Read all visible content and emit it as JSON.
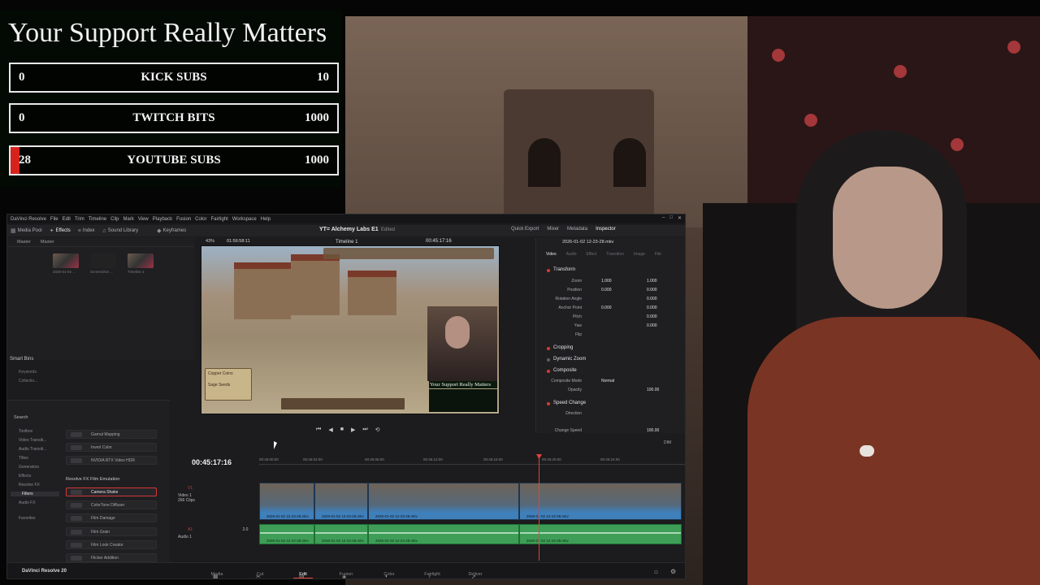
{
  "overlay": {
    "title": "Your Support Really Matters",
    "goals": [
      {
        "current": "0",
        "label": "KICK SUBS",
        "goal": "10",
        "progress": 0
      },
      {
        "current": "0",
        "label": "TWITCH BITS",
        "goal": "1000",
        "progress": 0
      },
      {
        "current": "28",
        "label": "YOUTUBE SUBS",
        "goal": "1000",
        "progress": 0.028
      }
    ]
  },
  "resolve": {
    "menu": [
      "DaVinci Resolve",
      "File",
      "Edit",
      "Trim",
      "Timeline",
      "Clip",
      "Mark",
      "View",
      "Playback",
      "Fusion",
      "Color",
      "Fairlight",
      "Workspace",
      "Help"
    ],
    "toolbar": {
      "media_pool": "Media Pool",
      "effects": "Effects",
      "index": "Index",
      "sound_library": "Sound Library",
      "keyframes": "Keyframes",
      "quick_export": "Quick Export",
      "mixer": "Mixer",
      "metadata": "Metadata",
      "inspector": "Inspector"
    },
    "project_title": "YT= Alchemy Labs E1",
    "edited": "Edited",
    "viewer": {
      "zoom": "43%",
      "source_tc": "01:56:58:11",
      "timeline_name": "Timeline 1",
      "record_tc": "00:45:17:16",
      "pip_title": "Your Support Really Matters",
      "note_line1": "Copper Coins",
      "note_line2": "Sage Seeds"
    },
    "media_pool": {
      "tab_master": "Master",
      "bin_master": "Master",
      "clips": [
        "2026-01-02 ...",
        "Screenshot ...",
        "Timeline 1"
      ],
      "smart_bins": "Smart Bins",
      "keywords": "Keywords",
      "collections": "Collectio..."
    },
    "effects_library": {
      "search": "Search",
      "tree": [
        "Toolbox",
        "Video Transiti...",
        "Audio Transiti...",
        "Titles",
        "Generators",
        "Effects",
        "Resolve FX",
        "Filters",
        "Audio FX",
        "Favorites"
      ],
      "items_top": [
        "Gamut Mapping",
        "Invert Color",
        "NVIDIA RTX Video HDR"
      ],
      "section": "Resolve FX Film Emulation",
      "items": [
        "Camera Shake",
        "ColorTone Diffuser",
        "Film Damage",
        "Film Grain",
        "Film Look Creator",
        "Flicker Addition"
      ]
    },
    "inspector": {
      "file": "2026-01-02 12-23-28.mkv",
      "tabs": [
        "Video",
        "Audio",
        "Effect",
        "Transition",
        "Image",
        "File"
      ],
      "transform": "Transform",
      "zoom": {
        "label": "Zoom",
        "x": "1.000",
        "y": "1.000"
      },
      "position": {
        "label": "Position",
        "x": "0.000",
        "y": "0.000"
      },
      "rotation": {
        "label": "Rotation Angle",
        "v": "0.000"
      },
      "anchor": {
        "label": "Anchor Point",
        "x": "0.000",
        "y": "0.000"
      },
      "pitch": {
        "label": "Pitch",
        "v": "0.000"
      },
      "yaw": {
        "label": "Yaw",
        "v": "0.000"
      },
      "flip": "Flip",
      "cropping": "Cropping",
      "dynamic_zoom": "Dynamic Zoom",
      "composite": "Composite",
      "composite_mode": {
        "label": "Composite Mode",
        "v": "Normal"
      },
      "opacity": {
        "label": "Opacity",
        "v": "100.00"
      },
      "speed_change": "Speed Change",
      "direction": "Direction",
      "change_speed": {
        "label": "Change Speed",
        "v": "100.00"
      }
    },
    "timeline": {
      "timecode": "00:45:17:16",
      "ruler": [
        "00:45:00:00",
        "00:45:04:00",
        "00:45:08:00",
        "00:45:12:00",
        "00:45:16:00",
        "00:45:20:00",
        "00:45:24:00"
      ],
      "v1": "V1",
      "video1": "Video 1",
      "video1_clips": "266 Clips",
      "a1": "A1",
      "audio1": "Audio 1",
      "audio_level": "2.0",
      "clip_name": "2026-01-02 12-23-28.mkv",
      "dim": "DIM"
    },
    "pages": [
      "Media",
      "Cut",
      "Edit",
      "Fusion",
      "Color",
      "Fairlight",
      "Deliver"
    ],
    "brand": "DaVinci Resolve 20"
  },
  "colors": {
    "accent": "#e4423a",
    "video_clip": "#3f7fba",
    "audio_clip": "#3e9e57",
    "goal_fill": "#d8231c"
  }
}
